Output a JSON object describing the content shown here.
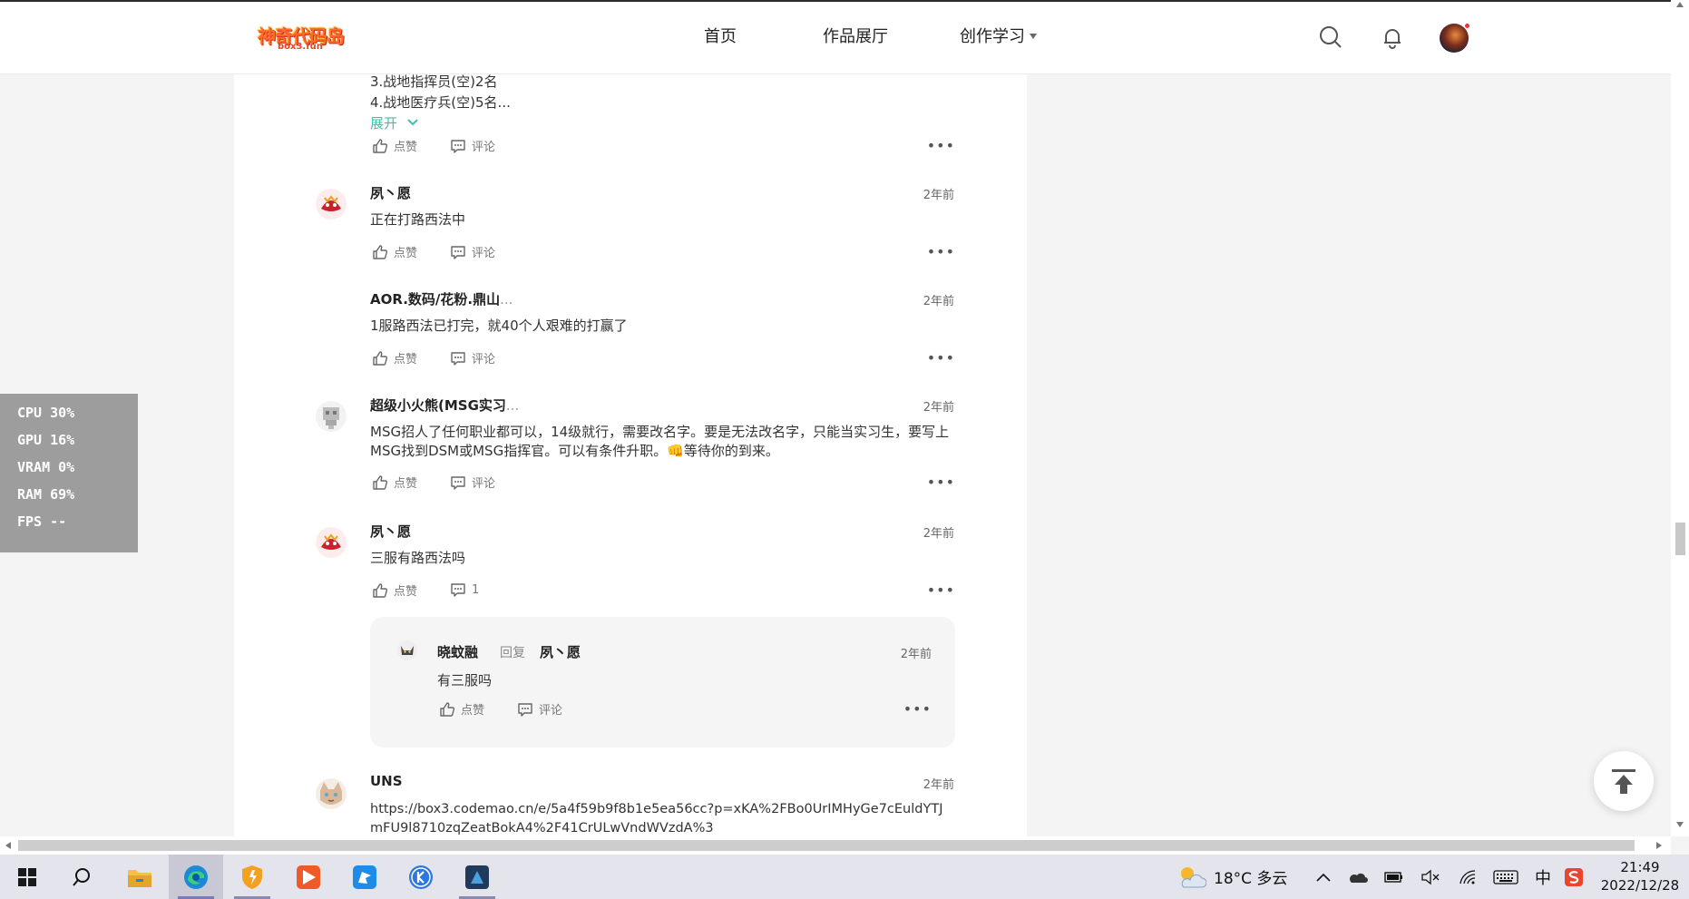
{
  "nav": {
    "logo_main": "神奇代码岛",
    "logo_sub": "box3.fun",
    "links": [
      "首页",
      "作品展厅",
      "创作学习"
    ]
  },
  "comments_top": {
    "lines": [
      "3.战地指挥员(空)2名",
      "4.战地医疗兵(空)5名..."
    ],
    "expand_label": "展开",
    "like_label": "点赞",
    "comment_label": "评论"
  },
  "comments": [
    {
      "name": "夙丶愿",
      "time": "2年前",
      "text": "正在打路西法中",
      "like": "点赞",
      "comment": "评论"
    },
    {
      "name": "AOR.数码/花粉.鼎山",
      "ellipsis": "...",
      "time": "2年前",
      "text": "1服路西法已打完，就40个人艰难的打赢了",
      "like": "点赞",
      "comment": "评论"
    },
    {
      "name": "超级小火熊(MSG实习",
      "ellipsis": "...",
      "time": "2年前",
      "text": "MSG招人了任何职业都可以，14级就行，需要改名字。要是无法改名字，只能当实习生，要写上MSG找到DSM或MSG指挥官。可以有条件升职。👊等待你的到来。",
      "like": "点赞",
      "comment": "评论"
    },
    {
      "name": "夙丶愿",
      "time": "2年前",
      "text": "三服有路西法吗",
      "like": "点赞",
      "comment": "1"
    },
    {
      "name": "UNS",
      "time": "2年前",
      "text": "https://box3.codemao.cn/e/5a4f59b9f8b1e5ea56cc?p=xKA%2FBo0UrIMHyGe7cEuldYTJmFU9l8710zqZeatBokA4%2F41CrULwVndWVzdA%3"
    }
  ],
  "reply": {
    "name": "晓蚊融",
    "reply_word": "回复",
    "target": "夙丶愿",
    "time": "2年前",
    "text": "有三服吗",
    "like": "点赞",
    "comment": "评论"
  },
  "perf": [
    "CPU  30%",
    "GPU  16%",
    "VRAM   0%",
    "RAM  69%",
    "FPS --"
  ],
  "taskbar": {
    "weather": "18°C  多云",
    "ime": "中",
    "time": "21:49",
    "date": "2022/12/28"
  },
  "colors": {
    "accent": "#3ec3a9",
    "notify_dot": "#ff2d2d"
  }
}
